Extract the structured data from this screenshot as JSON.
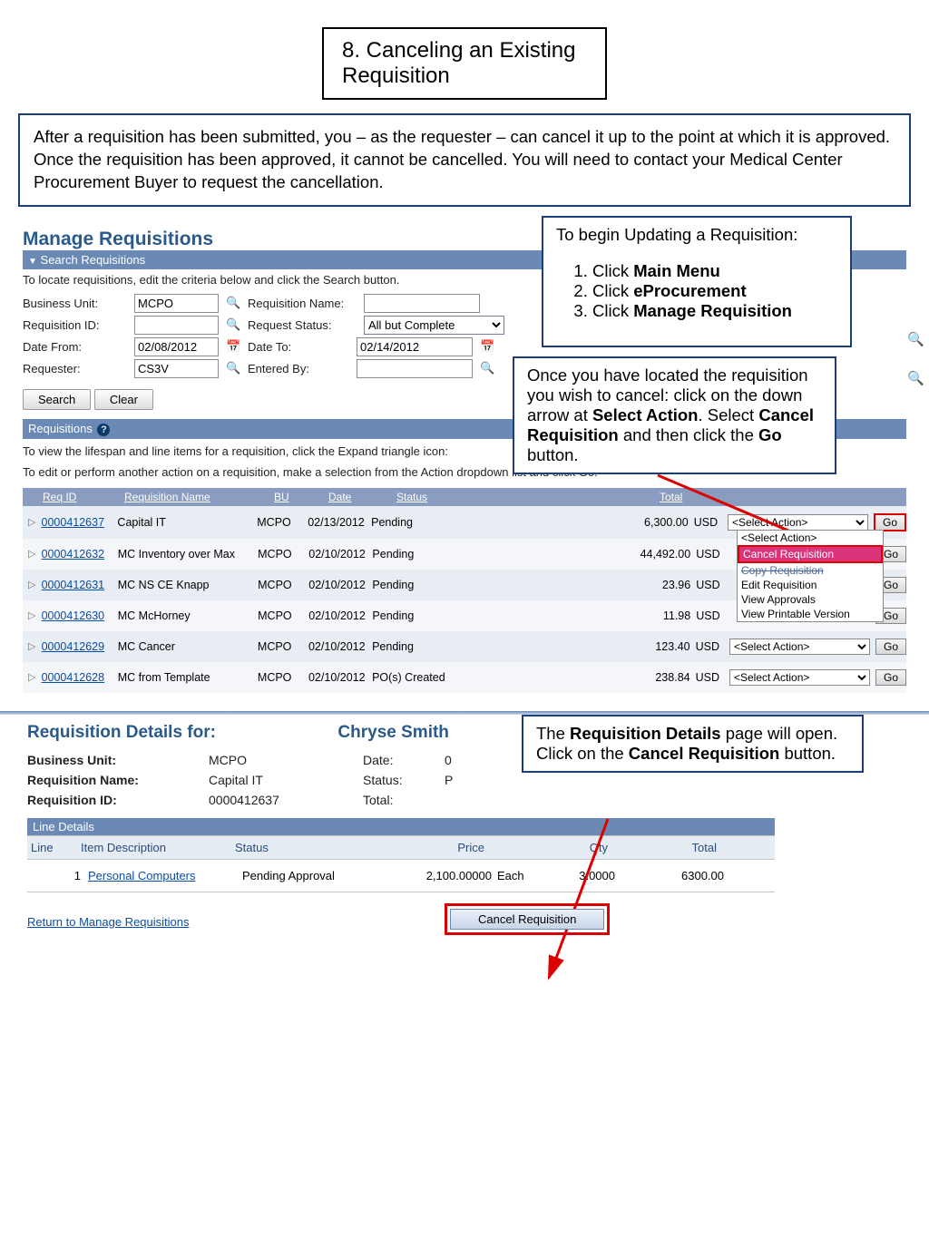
{
  "doc": {
    "title": "8. Canceling an Existing Requisition",
    "intro": "After a requisition has been submitted, you – as the requester – can cancel it up to the point at which it is approved.  Once the requisition has been approved, it cannot be cancelled.  You will need to contact your Medical Center Procurement Buyer to request the cancellation."
  },
  "callouts": {
    "begin": {
      "lead": "To begin Updating a Requisition:",
      "steps": [
        "Click ",
        "Main Menu",
        "Click ",
        "eProcurement",
        "Click ",
        "Manage Requisition"
      ]
    },
    "locate": "Once you have located the requisition you wish to cancel: click on the down arrow at Select Action. Select Cancel Requisition and then click the Go button.",
    "locate_parts": [
      "Once you have located the requisition you wish to cancel: click on the down arrow at ",
      "Select Action",
      ". Select ",
      "Cancel Requisition",
      " and then click the ",
      "Go",
      " button."
    ],
    "details": "The Requisition Details page will open.\nClick on the Cancel Requisition button.",
    "details_parts": [
      "The ",
      "Requisition Details",
      " page will open.",
      "Click on the ",
      "Cancel Requisition",
      " button."
    ]
  },
  "manage": {
    "title": "Manage Requisitions",
    "search_section": "Search Requisitions",
    "tip": "To locate requisitions, edit the criteria below and click the Search button.",
    "labels": {
      "bu": "Business Unit:",
      "reqname": "Requisition Name:",
      "reqid": "Requisition ID:",
      "reqstatus": "Request Status:",
      "from": "Date From:",
      "to": "Date To:",
      "requester": "Requester:",
      "entered": "Entered By:"
    },
    "values": {
      "bu": "MCPO",
      "reqid": "",
      "reqname": "",
      "status": "All but Complete",
      "from": "02/08/2012",
      "to": "02/14/2012",
      "requester": "CS3V",
      "entered": ""
    },
    "buttons": {
      "search": "Search",
      "clear": "Clear"
    },
    "req_section": "Requisitions",
    "hint1": "To view the lifespan and line items for a requisition, click the Expand triangle icon:",
    "hint2": "To edit or perform another action on a requisition, make a selection from the Action dropdown list and click Go."
  },
  "table": {
    "headers": {
      "reqid": "Req ID",
      "name": "Requisition Name",
      "bu": "BU",
      "date": "Date",
      "status": "Status",
      "total": "Total"
    },
    "action_placeholder": "<Select Action>",
    "go": "Go",
    "dropdown": {
      "select": "<Select Action>",
      "cancel": "Cancel Requisition",
      "copy": "Copy Requisition",
      "edit": "Edit Requisition",
      "approvals": "View Approvals",
      "print": "View Printable Version"
    },
    "rows": [
      {
        "id": "0000412637",
        "name": "Capital IT",
        "bu": "MCPO",
        "date": "02/13/2012",
        "status": "Pending",
        "total": "6,300.00",
        "cur": "USD"
      },
      {
        "id": "0000412632",
        "name": "MC Inventory over Max",
        "bu": "MCPO",
        "date": "02/10/2012",
        "status": "Pending",
        "total": "44,492.00",
        "cur": "USD"
      },
      {
        "id": "0000412631",
        "name": "MC NS CE Knapp",
        "bu": "MCPO",
        "date": "02/10/2012",
        "status": "Pending",
        "total": "23.96",
        "cur": "USD"
      },
      {
        "id": "0000412630",
        "name": "MC McHorney",
        "bu": "MCPO",
        "date": "02/10/2012",
        "status": "Pending",
        "total": "11.98",
        "cur": "USD"
      },
      {
        "id": "0000412629",
        "name": "MC Cancer",
        "bu": "MCPO",
        "date": "02/10/2012",
        "status": "Pending",
        "total": "123.40",
        "cur": "USD"
      },
      {
        "id": "0000412628",
        "name": "MC from Template",
        "bu": "MCPO",
        "date": "02/10/2012",
        "status": "PO(s) Created",
        "total": "238.84",
        "cur": "USD"
      }
    ]
  },
  "details": {
    "title": "Requisition Details for:",
    "user": "Chryse Smith",
    "labels": {
      "bu": "Business Unit:",
      "date": "Date:",
      "name": "Requisition Name:",
      "status": "Status:",
      "id": "Requisition ID:",
      "total": "Total:"
    },
    "values": {
      "bu": "MCPO",
      "date": "0",
      "name": "Capital IT",
      "status": "P",
      "id": "0000412637",
      "total": ""
    },
    "line_bar": "Line Details",
    "line_headers": {
      "line": "Line",
      "desc": "Item Description",
      "status": "Status",
      "price": "Price",
      "qty": "Qty",
      "total": "Total"
    },
    "line": {
      "num": "1",
      "desc": "Personal Computers",
      "status": "Pending Approval",
      "price": "2,100.00000",
      "uom": "Each",
      "qty": "3.0000",
      "total": "6300.00"
    },
    "return": "Return to Manage Requisitions",
    "cancel_btn": "Cancel Requisition"
  }
}
